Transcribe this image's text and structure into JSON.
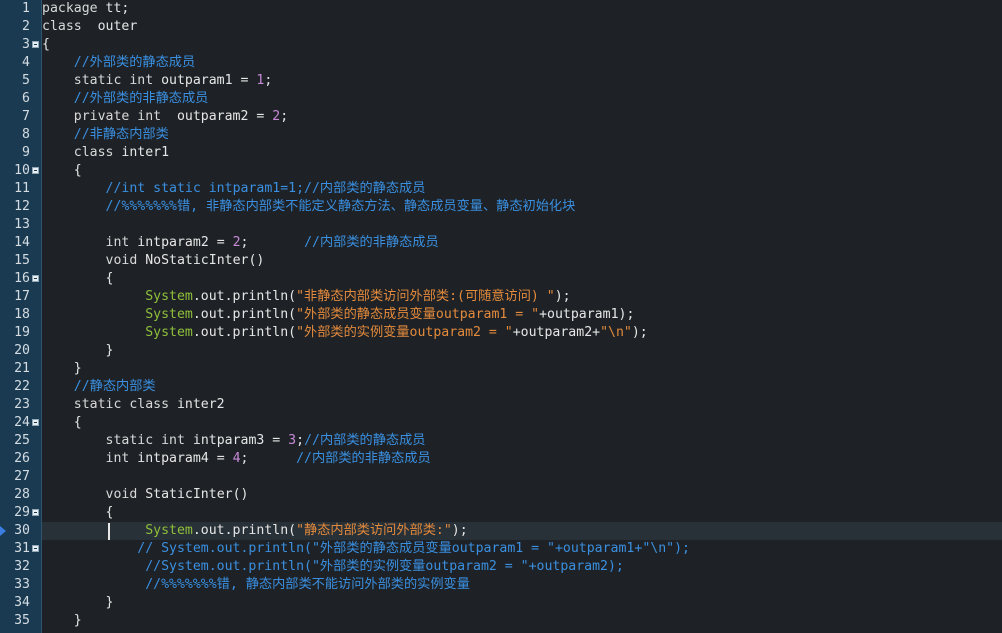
{
  "editor": {
    "current_line": 30,
    "lines": [
      {
        "n": "1",
        "segs": [
          [
            "kw",
            "package "
          ],
          [
            "pl",
            "tt;"
          ]
        ]
      },
      {
        "n": "2",
        "segs": [
          [
            "kw",
            "class  "
          ],
          [
            "pl",
            "outer"
          ]
        ]
      },
      {
        "n": "3",
        "fold": true,
        "segs": [
          [
            "pl",
            "{"
          ]
        ]
      },
      {
        "n": "4",
        "segs": [
          [
            "pl",
            "    "
          ],
          [
            "cm",
            "//外部类的静态成员"
          ]
        ]
      },
      {
        "n": "5",
        "segs": [
          [
            "pl",
            "    "
          ],
          [
            "kw",
            "static int "
          ],
          [
            "pl",
            "outparam1 = "
          ],
          [
            "num",
            "1"
          ],
          [
            "pl",
            ";"
          ]
        ]
      },
      {
        "n": "6",
        "segs": [
          [
            "pl",
            "    "
          ],
          [
            "cm",
            "//外部类的非静态成员"
          ]
        ]
      },
      {
        "n": "7",
        "segs": [
          [
            "pl",
            "    "
          ],
          [
            "kw",
            "private int  "
          ],
          [
            "pl",
            "outparam2 = "
          ],
          [
            "num",
            "2"
          ],
          [
            "pl",
            ";"
          ]
        ]
      },
      {
        "n": "8",
        "segs": [
          [
            "pl",
            "    "
          ],
          [
            "cm",
            "//非静态内部类"
          ]
        ]
      },
      {
        "n": "9",
        "segs": [
          [
            "pl",
            "    "
          ],
          [
            "kw",
            "class "
          ],
          [
            "pl",
            "inter1"
          ]
        ]
      },
      {
        "n": "10",
        "fold": true,
        "segs": [
          [
            "pl",
            "    {"
          ]
        ]
      },
      {
        "n": "11",
        "segs": [
          [
            "pl",
            "        "
          ],
          [
            "cm",
            "//int static intparam1=1;//内部类的静态成员"
          ]
        ]
      },
      {
        "n": "12",
        "segs": [
          [
            "pl",
            "        "
          ],
          [
            "cm",
            "//%%%%%%%错, 非静态内部类不能定义静态方法、静态成员变量、静态初始化块"
          ]
        ]
      },
      {
        "n": "13",
        "segs": []
      },
      {
        "n": "14",
        "segs": [
          [
            "pl",
            "        "
          ],
          [
            "kw",
            "int "
          ],
          [
            "pl",
            "intparam2 = "
          ],
          [
            "num",
            "2"
          ],
          [
            "pl",
            ";       "
          ],
          [
            "cm",
            "//内部类的非静态成员"
          ]
        ]
      },
      {
        "n": "15",
        "segs": [
          [
            "pl",
            "        "
          ],
          [
            "kw",
            "void "
          ],
          [
            "pl",
            "NoStaticInter()"
          ]
        ]
      },
      {
        "n": "16",
        "fold": true,
        "segs": [
          [
            "pl",
            "        {"
          ]
        ]
      },
      {
        "n": "17",
        "segs": [
          [
            "pl",
            "             "
          ],
          [
            "cls",
            "System"
          ],
          [
            "pl",
            ".out.println("
          ],
          [
            "st",
            "\"非静态内部类访问外部类:(可随意访问) \""
          ],
          [
            "pl",
            ");"
          ]
        ]
      },
      {
        "n": "18",
        "segs": [
          [
            "pl",
            "             "
          ],
          [
            "cls",
            "System"
          ],
          [
            "pl",
            ".out.println("
          ],
          [
            "st",
            "\"外部类的静态成员变量outparam1 = \""
          ],
          [
            "pl",
            "+outparam1);"
          ]
        ]
      },
      {
        "n": "19",
        "segs": [
          [
            "pl",
            "             "
          ],
          [
            "cls",
            "System"
          ],
          [
            "pl",
            ".out.println("
          ],
          [
            "st",
            "\"外部类的实例变量outparam2 = \""
          ],
          [
            "pl",
            "+outparam2+"
          ],
          [
            "st",
            "\"\\n\""
          ],
          [
            "pl",
            ");"
          ]
        ]
      },
      {
        "n": "20",
        "segs": [
          [
            "pl",
            "        }"
          ]
        ]
      },
      {
        "n": "21",
        "segs": [
          [
            "pl",
            "    }"
          ]
        ]
      },
      {
        "n": "22",
        "segs": [
          [
            "pl",
            "    "
          ],
          [
            "cm",
            "//静态内部类"
          ]
        ]
      },
      {
        "n": "23",
        "segs": [
          [
            "pl",
            "    "
          ],
          [
            "kw",
            "static class "
          ],
          [
            "pl",
            "inter2"
          ]
        ]
      },
      {
        "n": "24",
        "fold": true,
        "segs": [
          [
            "pl",
            "    {"
          ]
        ]
      },
      {
        "n": "25",
        "segs": [
          [
            "pl",
            "        "
          ],
          [
            "kw",
            "static int "
          ],
          [
            "pl",
            "intparam3 = "
          ],
          [
            "num",
            "3"
          ],
          [
            "pl",
            ";"
          ],
          [
            "cm",
            "//内部类的静态成员"
          ]
        ]
      },
      {
        "n": "26",
        "segs": [
          [
            "pl",
            "        "
          ],
          [
            "kw",
            "int "
          ],
          [
            "pl",
            "intparam4 = "
          ],
          [
            "num",
            "4"
          ],
          [
            "pl",
            ";      "
          ],
          [
            "cm",
            "//内部类的非静态成员"
          ]
        ]
      },
      {
        "n": "27",
        "segs": []
      },
      {
        "n": "28",
        "segs": [
          [
            "pl",
            "        "
          ],
          [
            "kw",
            "void "
          ],
          [
            "pl",
            "StaticInter()"
          ]
        ]
      },
      {
        "n": "29",
        "fold": true,
        "segs": [
          [
            "pl",
            "        {"
          ]
        ]
      },
      {
        "n": "30",
        "segs": [
          [
            "pl",
            "             "
          ],
          [
            "cls",
            "System"
          ],
          [
            "pl",
            ".out.println("
          ],
          [
            "st",
            "\"静态内部类访问外部类:\""
          ],
          [
            "pl",
            ");"
          ]
        ]
      },
      {
        "n": "31",
        "fold": true,
        "segs": [
          [
            "pl",
            "            "
          ],
          [
            "cm",
            "// System.out.println(\"外部类的静态成员变量outparam1 = \"+outparam1+\"\\n\");"
          ]
        ]
      },
      {
        "n": "32",
        "segs": [
          [
            "pl",
            "             "
          ],
          [
            "cm",
            "//System.out.println(\"外部类的实例变量outparam2 = \"+outparam2);"
          ]
        ]
      },
      {
        "n": "33",
        "segs": [
          [
            "pl",
            "             "
          ],
          [
            "cm",
            "//%%%%%%%错, 静态内部类不能访问外部类的实例变量"
          ]
        ]
      },
      {
        "n": "34",
        "segs": [
          [
            "pl",
            "        }"
          ]
        ]
      },
      {
        "n": "35",
        "segs": [
          [
            "pl",
            "    }"
          ]
        ]
      }
    ]
  }
}
